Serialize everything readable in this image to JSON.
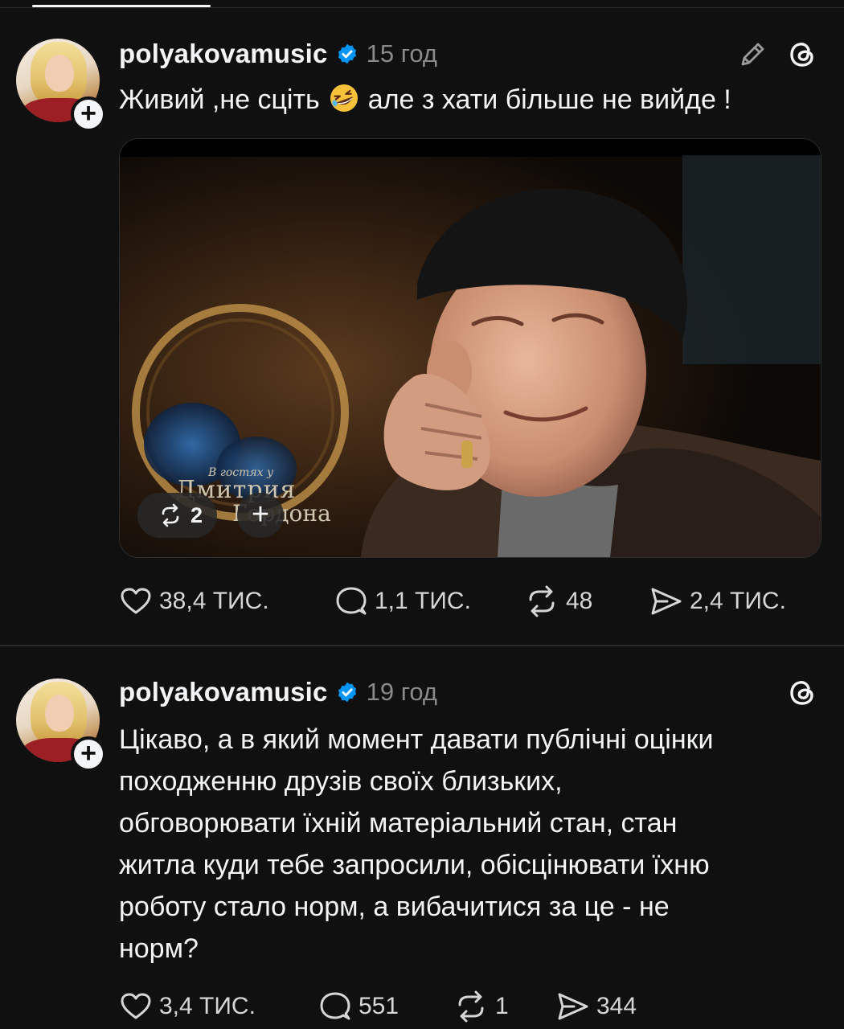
{
  "posts": [
    {
      "username": "polyakovamusic",
      "time": "15 год",
      "text": "Живий ,не сціть",
      "text_after_emoji": "але з хати більше не вийде !",
      "emoji": "rofl-emoji",
      "media": {
        "watermark_small": "В гостях у",
        "watermark_line1": "Дмитрия",
        "watermark_line2": "Гордона",
        "repost_count": "2"
      },
      "actions": {
        "likes": "38,4 ТИС.",
        "replies": "1,1 ТИС.",
        "reposts": "48",
        "shares": "2,4 ТИС."
      }
    },
    {
      "username": "polyakovamusic",
      "time": "19 год",
      "text": "Цікаво, а в який момент давати публічні оцінки\nпоходженню друзів своїх близьких,\nобговорювати їхній матеріальний стан, стан\nжитла куди тебе запросили, обісцінювати їхню\nроботу стало норм, а вибачитися за це - не\nнорм?",
      "actions": {
        "likes": "3,4 ТИС.",
        "replies": "551",
        "reposts": "1",
        "shares": "344"
      }
    }
  ],
  "icons": {
    "verified": "verified-badge-icon",
    "edit": "pencil-icon",
    "threads": "threads-logo-icon",
    "follow": "plus-icon",
    "like": "heart-icon",
    "reply": "comment-icon",
    "repost": "repost-icon",
    "share": "send-icon"
  },
  "colors": {
    "background": "#101010",
    "text": "#f3f5f7",
    "secondary": "#8a8a8a",
    "verified": "#0095f6"
  }
}
